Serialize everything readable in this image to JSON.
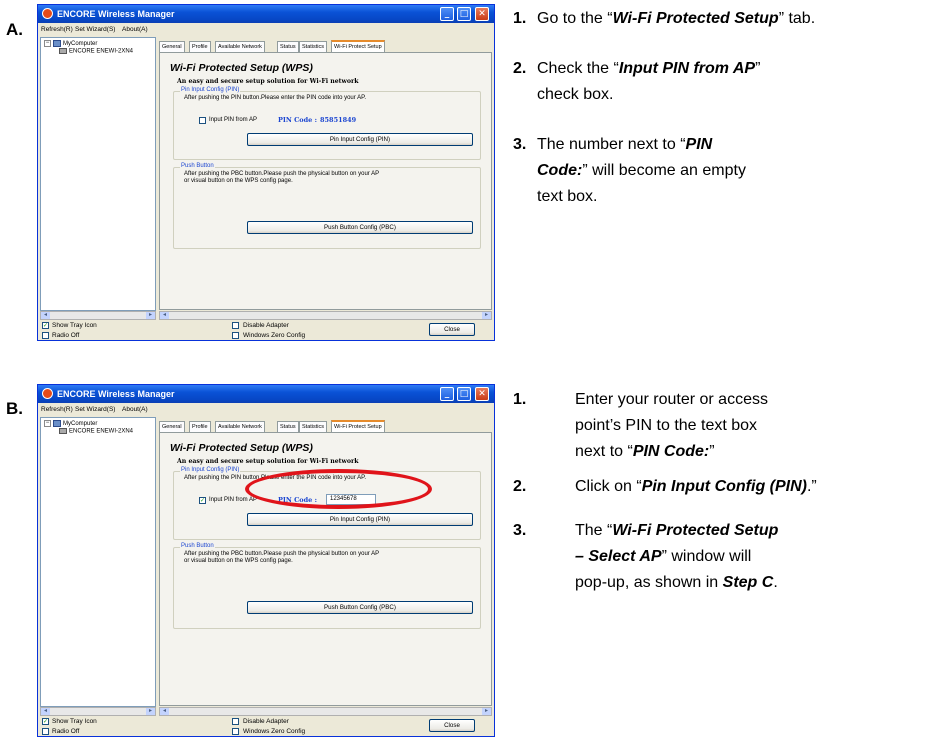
{
  "window": {
    "title": "ENCORE Wireless Manager",
    "menu": [
      "Refresh(R)",
      "Set Wizard(S)",
      "About(A)"
    ],
    "tree": {
      "root": "MyComputer",
      "device": "ENCORE ENEWI-2XN4"
    },
    "tabs": [
      "General",
      "Profile",
      "Available Network",
      "Status",
      "Statistics",
      "Wi-Fi Protect Setup"
    ],
    "wps_title": "Wi-Fi Protected Setup (WPS)",
    "wps_subtitle": "An easy and secure setup solution for Wi-Fi network",
    "pin_group": {
      "legend": "Pin Input Config (PIN)",
      "desc": "After pushing the PIN button.Please enter the PIN code into your AP.",
      "checkbox_label": "Input PIN from AP",
      "pin_label": "PIN Code :",
      "button": "Pin Input Config (PIN)"
    },
    "pbc_group": {
      "legend": "Push Button",
      "desc_line1": "After pushing the PBC button.Please push the physical button on your AP",
      "desc_line2": "or visual button on the WPS config page.",
      "button": "Push Button Config (PBC)"
    },
    "bottom": {
      "show_tray": "Show Tray Icon",
      "radio_off": "Radio Off",
      "disable_adapter": "Disable Adapter",
      "windows_zero": "Windows Zero Config",
      "close": "Close"
    }
  },
  "steps": [
    {
      "letter": "A.",
      "pin_value": "85851849",
      "pin_checked": false,
      "items": [
        {
          "num": "1.",
          "pre": "Go to the “",
          "em": "Wi-Fi Protected Setup",
          "post": "” tab."
        },
        {
          "num": "2.",
          "pre": "Check the “",
          "em": "Input PIN from AP",
          "post": "” check box."
        },
        {
          "num": "3.",
          "pre": "The number next to “",
          "em": "PIN Code:",
          "post": "” will become an empty text box."
        }
      ]
    },
    {
      "letter": "B.",
      "pin_value": "12345678",
      "pin_checked": true,
      "items": [
        {
          "num": "1.",
          "pre": "Enter your router or access point’s PIN to the text box next to “",
          "em": "PIN Code:",
          "post": "”"
        },
        {
          "num": "2.",
          "pre": "Click on “",
          "em": "Pin Input Config (PIN)",
          "post": ".”"
        },
        {
          "num": "3.",
          "pre": "The “",
          "em": "Wi-Fi Protected Setup – Select AP",
          "post": "” window will pop-up, as shown in ",
          "em2": "Step C",
          "post2": "."
        }
      ]
    }
  ]
}
